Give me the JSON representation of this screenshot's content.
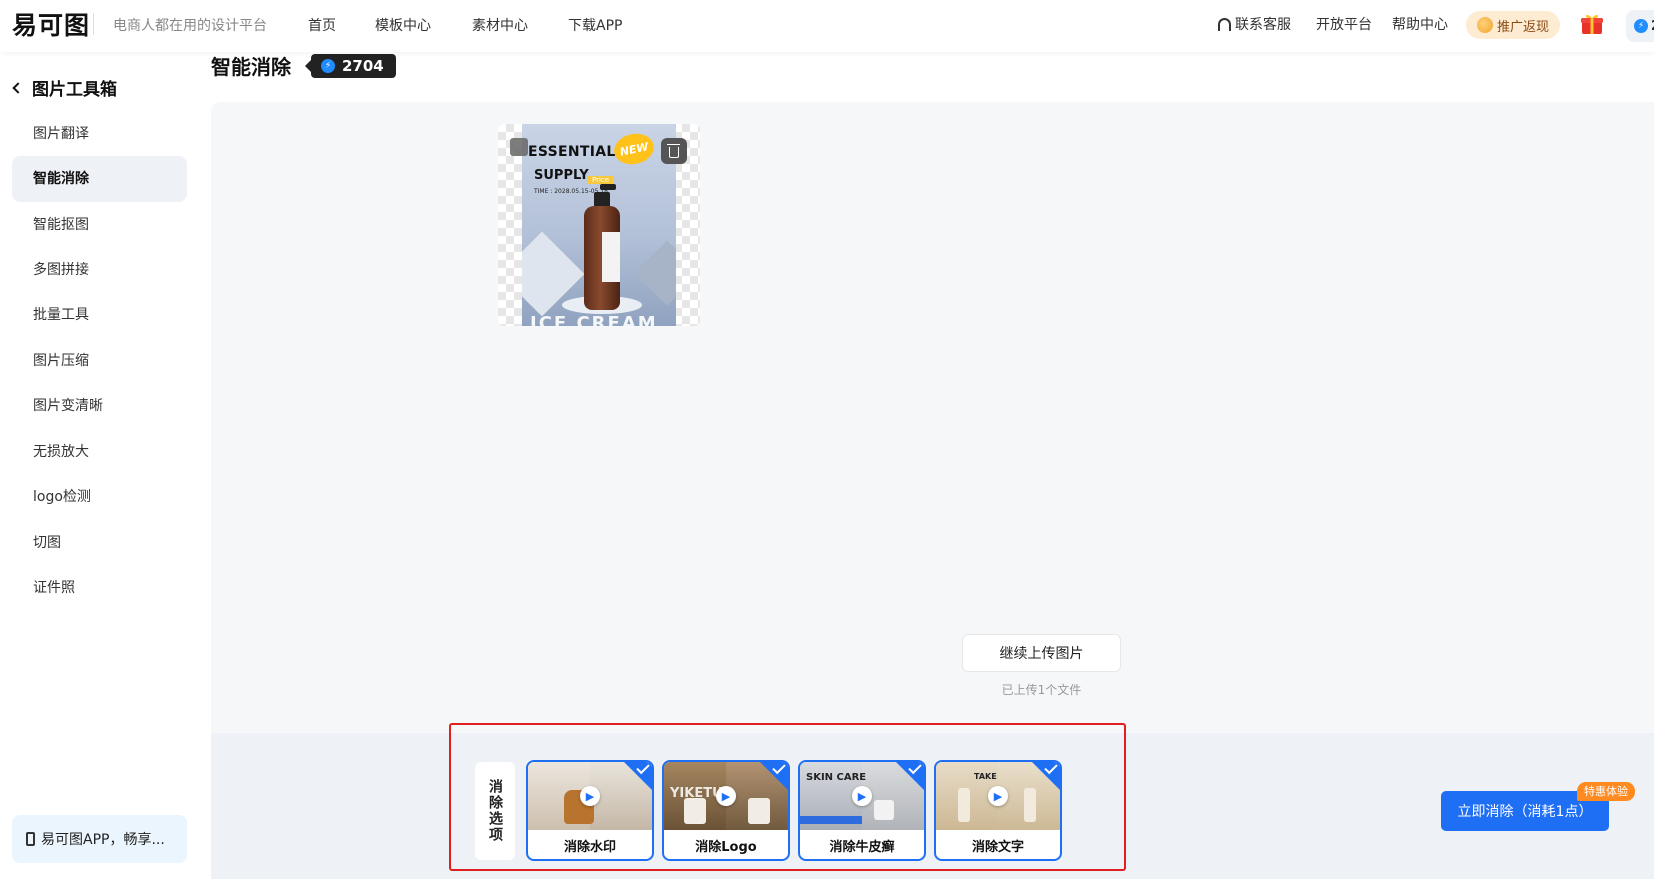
{
  "header": {
    "logo_text": "易可图",
    "slogan": "电商人都在用的设计平台",
    "nav": [
      "首页",
      "模板中心",
      "素材中心",
      "下载APP"
    ],
    "right_nav": [
      "联系客服",
      "开放平台",
      "帮助中心"
    ],
    "promo_label": "推广返现",
    "points_partial": "2"
  },
  "sidebar": {
    "title": "图片工具箱",
    "items": [
      {
        "label": "图片翻译",
        "active": false
      },
      {
        "label": "智能消除",
        "active": true
      },
      {
        "label": "智能抠图",
        "active": false
      },
      {
        "label": "多图拼接",
        "active": false
      },
      {
        "label": "批量工具",
        "active": false
      },
      {
        "label": "图片压缩",
        "active": false
      },
      {
        "label": "图片变清晰",
        "active": false
      },
      {
        "label": "无损放大",
        "active": false
      },
      {
        "label": "logo检测",
        "active": false
      },
      {
        "label": "切图",
        "active": false
      },
      {
        "label": "证件照",
        "active": false
      }
    ],
    "app_promo": "易可图APP，畅享..."
  },
  "main": {
    "title": "智能消除",
    "credits": "2704",
    "poster": {
      "line1": "ESSENTIAL",
      "line2": "SUPPLY",
      "badge": "NEW",
      "price": "Price",
      "time": "TIME : 2028.05.15-05.18",
      "bottom": "ICE CREAM"
    },
    "upload_more": "继续上传图片",
    "upload_status": "已上传1个文件"
  },
  "options": {
    "label": "消除选项",
    "cards": [
      {
        "caption": "消除水印",
        "overlay": "",
        "checked": true
      },
      {
        "caption": "消除Logo",
        "overlay": "YIKETU",
        "checked": true
      },
      {
        "caption": "消除牛皮癣",
        "overlay": "SKIN CARE",
        "checked": true
      },
      {
        "caption": "消除文字",
        "overlay": "TAKE",
        "checked": true
      }
    ],
    "primary_button": "立即消除（消耗1点）",
    "promo_tag": "特惠体验"
  },
  "colors": {
    "accent": "#1f6ff5",
    "highlight_frame": "#e02020",
    "promo_orange": "#ff8a1f"
  }
}
